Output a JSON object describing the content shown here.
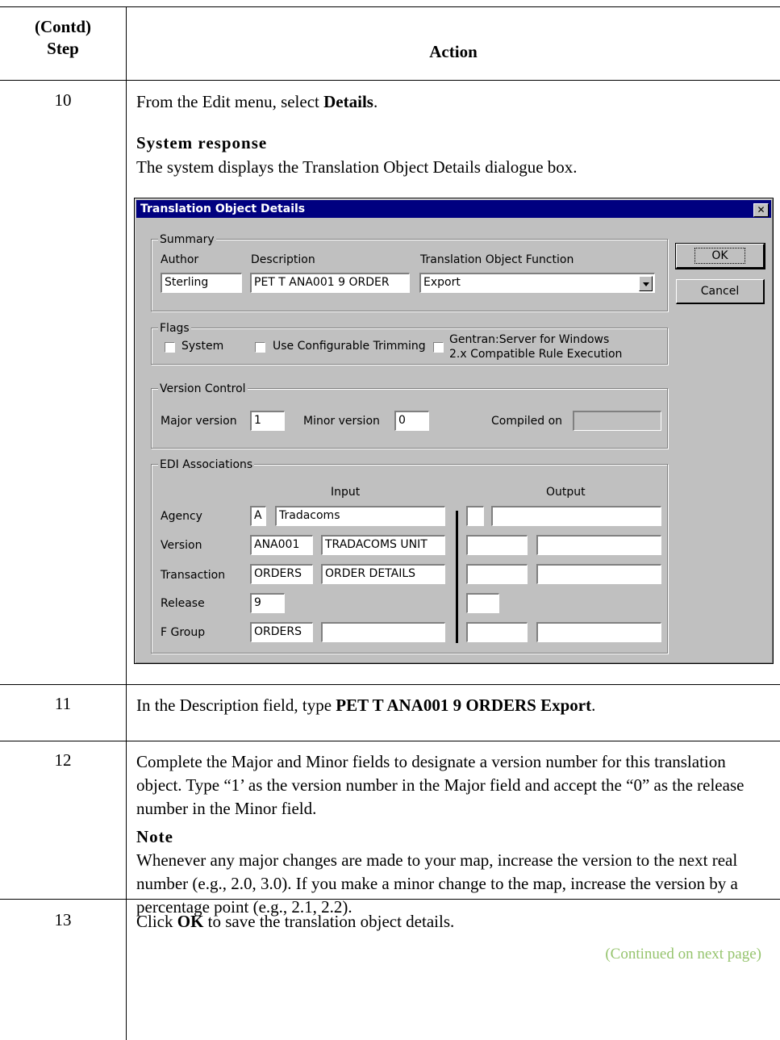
{
  "table": {
    "header_step_line1": "(Contd)",
    "header_step_line2": "Step",
    "header_action": "Action"
  },
  "steps": [
    {
      "number": "10",
      "text_before": "From the Edit menu, select ",
      "text_bold": "Details",
      "text_after": ".",
      "response_heading": "System response",
      "response_text": "The system displays the Translation Object Details dialogue box."
    },
    {
      "number": "11",
      "text_before": "In the Description field, type ",
      "text_bold": "PET T ANA001 9 ORDERS Export",
      "text_after": "."
    },
    {
      "number": "12",
      "text": "Complete the Major and Minor fields to designate a version number for this translation object. Type “1’ as the version number in the Major field and accept the “0” as the release number in the Minor field.",
      "note_heading": "Note",
      "note_text": "Whenever any major changes are made to your map, increase the version to the next real number (e.g., 2.0, 3.0). If you make a minor change to the map, increase the version by a percentage point (e.g., 2.1, 2.2)."
    },
    {
      "number": "13",
      "text_before": "Click ",
      "text_bold": "OK",
      "text_after": " to save the translation object details."
    }
  ],
  "continued": "(Continued on next page)",
  "dialog": {
    "title": "Translation Object Details",
    "close_glyph": "✕",
    "ok_label": "OK",
    "cancel_label": "Cancel",
    "summary": {
      "group_label": "Summary",
      "author_label": "Author",
      "author_value": "Sterling",
      "description_label": "Description",
      "description_value": "PET T ANA001 9 ORDER",
      "function_label": "Translation Object Function",
      "function_value": "Export"
    },
    "flags": {
      "group_label": "Flags",
      "system_label": "System",
      "trimming_label": "Use Configurable Trimming",
      "gentran_label_line1": "Gentran:Server for Windows",
      "gentran_label_line2": "2.x Compatible Rule Execution"
    },
    "version_control": {
      "group_label": "Version Control",
      "major_label": "Major version",
      "major_value": "1",
      "minor_label": "Minor version",
      "minor_value": "0",
      "compiled_label": "Compiled on",
      "compiled_value": ""
    },
    "edi": {
      "group_label": "EDI Associations",
      "input_header": "Input",
      "output_header": "Output",
      "agency_label": "Agency",
      "agency_code": "A",
      "agency_name": "Tradacoms",
      "version_label": "Version",
      "version_code": "ANA001",
      "version_name": "TRADACOMS UNIT",
      "transaction_label": "Transaction",
      "transaction_code": "ORDERS",
      "transaction_name": "ORDER DETAILS",
      "release_label": "Release",
      "release_value": "9",
      "fgroup_label": "F Group",
      "fgroup_code": "ORDERS",
      "fgroup_name": ""
    }
  }
}
